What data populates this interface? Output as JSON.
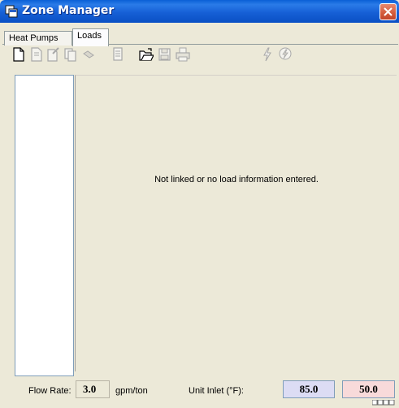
{
  "window": {
    "title": "Zone Manager",
    "colors": {
      "titlebar": "#0a5fd6",
      "close": "#d25a3a",
      "face": "#ece9d8"
    }
  },
  "tabs": [
    {
      "label": "Heat Pumps",
      "active": false
    },
    {
      "label": "Loads",
      "active": true
    }
  ],
  "toolbar": {
    "buttons": [
      {
        "icon": "new-document-icon"
      },
      {
        "icon": "copy-document-icon"
      },
      {
        "icon": "edit-document-icon"
      },
      {
        "icon": "duplicate-document-icon"
      },
      {
        "icon": "link-icon"
      },
      {
        "icon": "properties-icon"
      },
      {
        "icon": "open-folder-icon"
      },
      {
        "icon": "save-icon"
      },
      {
        "icon": "print-icon"
      },
      {
        "icon": "lightning-icon"
      },
      {
        "icon": "lightning-circle-icon"
      }
    ]
  },
  "main": {
    "message": "Not linked or no load information entered."
  },
  "footer": {
    "flow_rate_label": "Flow Rate:",
    "flow_rate_value": "3.0",
    "flow_rate_unit": "gpm/ton",
    "unit_inlet_label": "Unit Inlet (°F):",
    "unit_inlet_value_1": "85.0",
    "unit_inlet_value_2": "50.0"
  }
}
